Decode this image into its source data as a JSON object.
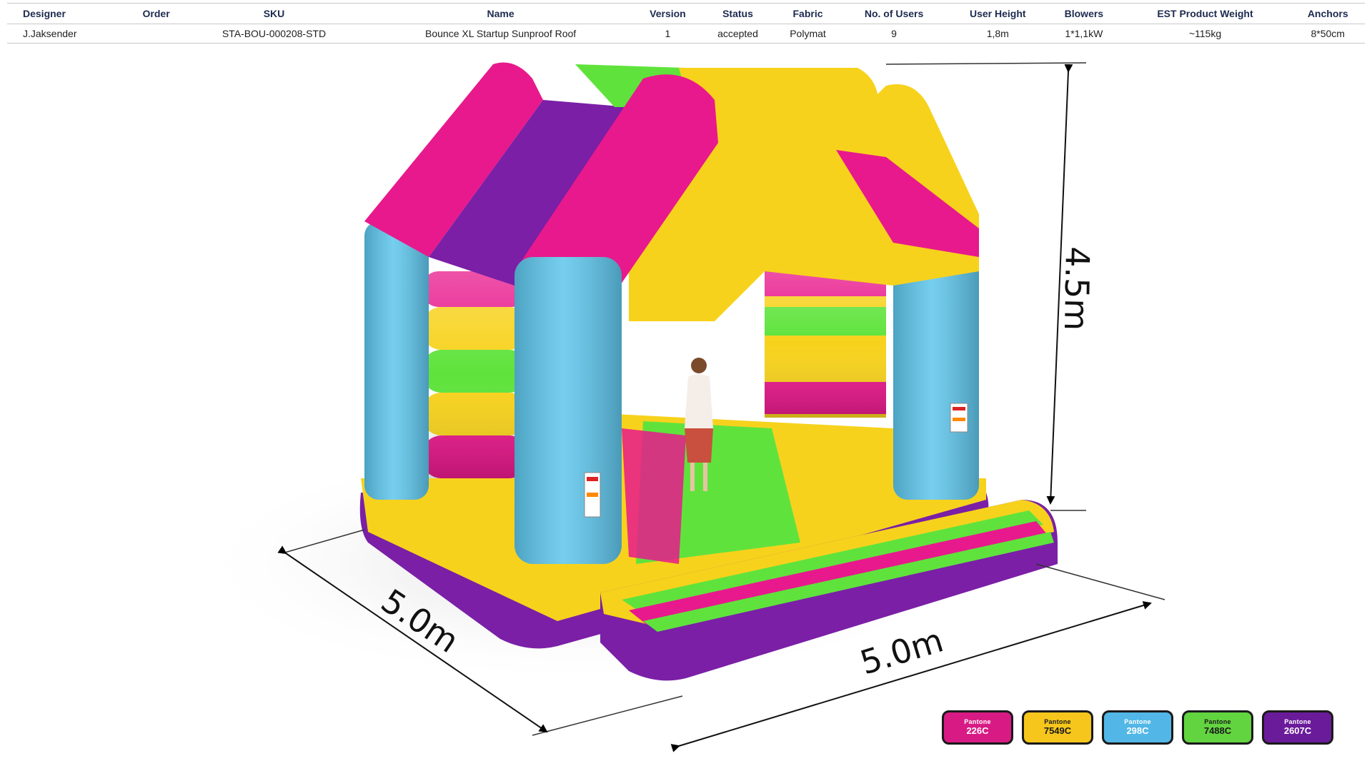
{
  "spec_table": {
    "headers": [
      "Designer",
      "Order",
      "SKU",
      "Name",
      "Version",
      "Status",
      "Fabric",
      "No. of Users",
      "User  Height",
      "Blowers",
      "EST Product Weight",
      "Anchors"
    ],
    "row": [
      "J.Jaksender",
      "",
      "STA-BOU-000208-STD",
      "Bounce XL Startup Sunproof Roof",
      "1",
      "accepted",
      "Polymat",
      "9",
      "1,8m",
      "1*1,1kW",
      "~115kg",
      "8*50cm"
    ]
  },
  "dimensions": {
    "height": "4.5m",
    "depth": "5.0m",
    "width": "5.0m"
  },
  "colors": {
    "pink": "#e8198c",
    "yellow": "#f7d21c",
    "blue": "#5ec6ec",
    "green": "#5fe33c",
    "purple": "#7a1fa6"
  },
  "swatches": [
    {
      "brand": "Pantone",
      "code": "226C",
      "color": "#d81b84"
    },
    {
      "brand": "Pantone",
      "code": "7549C",
      "color": "#f6c61c"
    },
    {
      "brand": "Pantone",
      "code": "298C",
      "color": "#52b7e6"
    },
    {
      "brand": "Pantone",
      "code": "7488C",
      "color": "#62d440"
    },
    {
      "brand": "Pantone",
      "code": "2607C",
      "color": "#6a1b9a"
    }
  ]
}
